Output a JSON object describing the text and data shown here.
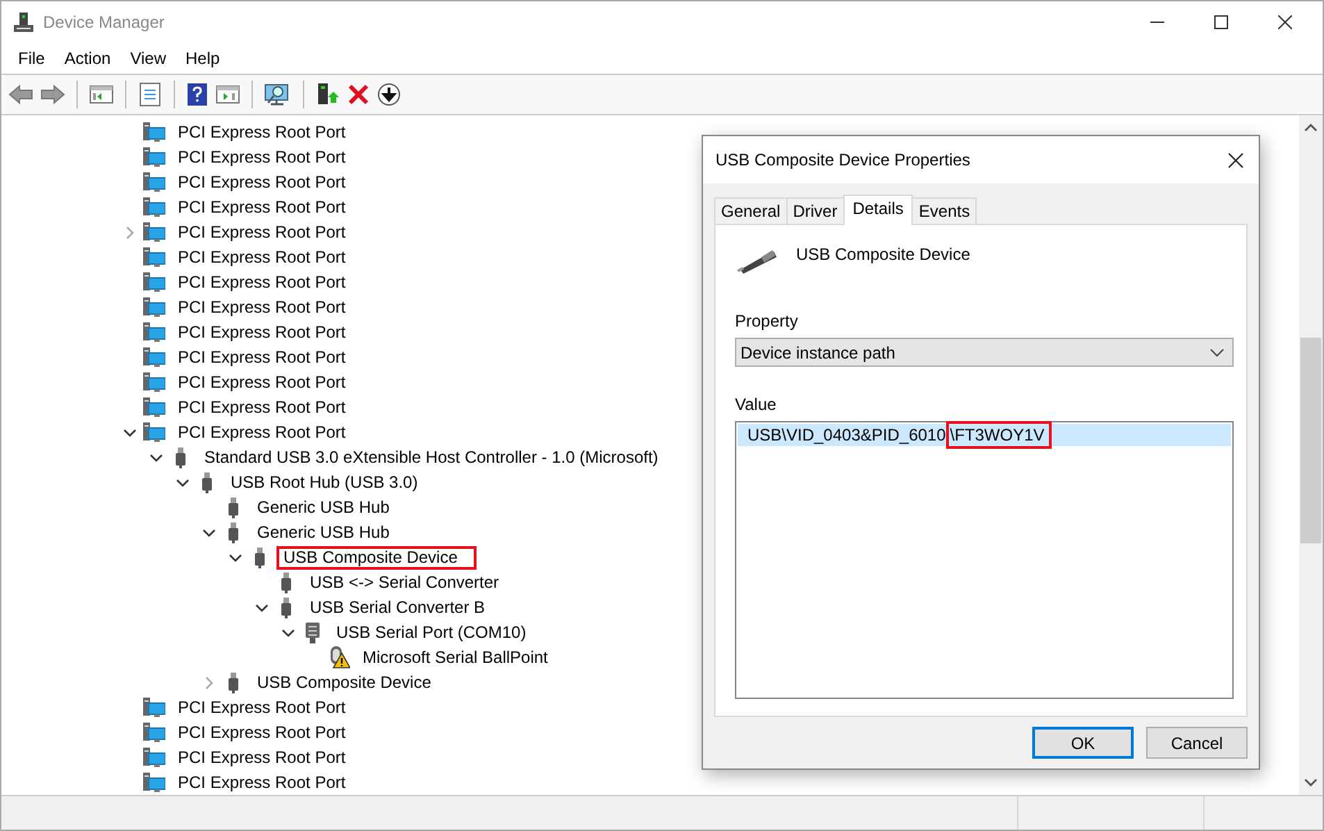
{
  "window": {
    "title": "Device Manager"
  },
  "menu": [
    "File",
    "Action",
    "View",
    "Help"
  ],
  "tree": [
    {
      "label": "PCI Express Root Port",
      "kind": "pci",
      "highlighted": false
    },
    {
      "label": "PCI Express Root Port",
      "kind": "pci",
      "highlighted": false
    },
    {
      "label": "PCI Express Root Port",
      "kind": "pci",
      "highlighted": false
    },
    {
      "label": "PCI Express Root Port",
      "kind": "pci",
      "highlighted": false
    },
    {
      "label": "PCI Express Root Port",
      "kind": "pci",
      "highlighted": false,
      "expanded": false
    },
    {
      "label": "PCI Express Root Port",
      "kind": "pci",
      "highlighted": false
    },
    {
      "label": "PCI Express Root Port",
      "kind": "pci",
      "highlighted": false
    },
    {
      "label": "PCI Express Root Port",
      "kind": "pci",
      "highlighted": false
    },
    {
      "label": "PCI Express Root Port",
      "kind": "pci",
      "highlighted": false
    },
    {
      "label": "PCI Express Root Port",
      "kind": "pci",
      "highlighted": false
    },
    {
      "label": "PCI Express Root Port",
      "kind": "pci",
      "highlighted": false
    },
    {
      "label": "PCI Express Root Port",
      "kind": "pci",
      "highlighted": false
    },
    {
      "label": "PCI Express Root Port",
      "kind": "pci",
      "highlighted": false,
      "expanded": true,
      "children": [
        {
          "label": "Standard USB 3.0 eXtensible Host Controller - 1.0 (Microsoft)",
          "kind": "usb",
          "highlighted": false,
          "expanded": true,
          "children": [
            {
              "label": "USB Root Hub (USB 3.0)",
              "kind": "usb",
              "highlighted": false,
              "expanded": true,
              "children": [
                {
                  "label": "Generic USB Hub",
                  "kind": "usb",
                  "highlighted": false
                },
                {
                  "label": "Generic USB Hub",
                  "kind": "usb",
                  "highlighted": false,
                  "expanded": true,
                  "children": [
                    {
                      "label": "USB Composite Device",
                      "kind": "usb",
                      "highlighted": true,
                      "expanded": true,
                      "children": [
                        {
                          "label": "USB <-> Serial Converter",
                          "kind": "usb",
                          "highlighted": false
                        },
                        {
                          "label": "USB Serial Converter B",
                          "kind": "usb",
                          "highlighted": false,
                          "expanded": true,
                          "children": [
                            {
                              "label": "USB Serial Port (COM10)",
                              "kind": "port",
                              "highlighted": false,
                              "expanded": true,
                              "children": [
                                {
                                  "label": "Microsoft Serial BallPoint",
                                  "kind": "warning",
                                  "highlighted": false
                                }
                              ]
                            }
                          ]
                        }
                      ]
                    }
                  ]
                },
                {
                  "label": "USB Composite Device",
                  "kind": "usb",
                  "highlighted": false,
                  "expanded": false
                }
              ]
            }
          ]
        }
      ]
    },
    {
      "label": "PCI Express Root Port",
      "kind": "pci",
      "highlighted": false
    },
    {
      "label": "PCI Express Root Port",
      "kind": "pci",
      "highlighted": false
    },
    {
      "label": "PCI Express Root Port",
      "kind": "pci",
      "highlighted": false
    },
    {
      "label": "PCI Express Root Port",
      "kind": "pci",
      "highlighted": false
    }
  ],
  "dialog": {
    "title": "USB Composite Device Properties",
    "tabs": [
      {
        "label": "General",
        "selected": false
      },
      {
        "label": "Driver",
        "selected": false
      },
      {
        "label": "Details",
        "selected": true
      },
      {
        "label": "Events",
        "selected": false
      }
    ],
    "device_name": "USB Composite Device",
    "property_label": "Property",
    "property_value": "Device instance path",
    "value_label": "Value",
    "values": [
      {
        "text": "USB\\VID_0403&PID_6010",
        "highlighted_text": "\\FT3WOY1V",
        "selected": true
      }
    ],
    "buttons": [
      {
        "label": "OK",
        "default": true
      },
      {
        "label": "Cancel",
        "default": false
      }
    ]
  }
}
